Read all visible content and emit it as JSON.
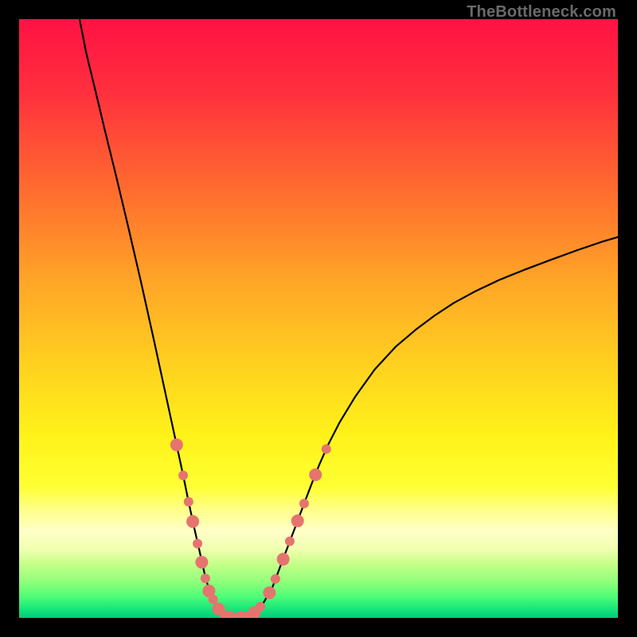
{
  "watermark": "TheBottleneck.com",
  "gradient_stops": [
    {
      "offset": 0.0,
      "color": "#ff1244"
    },
    {
      "offset": 0.12,
      "color": "#ff2f3e"
    },
    {
      "offset": 0.28,
      "color": "#ff6a2f"
    },
    {
      "offset": 0.44,
      "color": "#ffa627"
    },
    {
      "offset": 0.58,
      "color": "#ffd21f"
    },
    {
      "offset": 0.7,
      "color": "#fff31a"
    },
    {
      "offset": 0.78,
      "color": "#ffff33"
    },
    {
      "offset": 0.82,
      "color": "#ffff8a"
    },
    {
      "offset": 0.855,
      "color": "#ffffc8"
    },
    {
      "offset": 0.885,
      "color": "#f0ffb0"
    },
    {
      "offset": 0.91,
      "color": "#c6ff88"
    },
    {
      "offset": 0.94,
      "color": "#8fff7a"
    },
    {
      "offset": 0.965,
      "color": "#4dfd78"
    },
    {
      "offset": 0.985,
      "color": "#17e67a"
    },
    {
      "offset": 1.0,
      "color": "#00cc7a"
    }
  ],
  "curve_style": {
    "stroke": "#000000",
    "stroke_width": 2.2
  },
  "marker_style": {
    "fill": "#e5746f",
    "radius_large": 8,
    "radius_small": 6
  },
  "chart_data": {
    "type": "line",
    "title": "",
    "xlabel": "",
    "ylabel": "",
    "xlim": [
      0,
      100
    ],
    "ylim": [
      0,
      100
    ],
    "grid": false,
    "note": "Axes are unlabeled. x/y values are normalized 0–100 from pixel position; y is measured upward (0 at bottom of plot, 100 at top).",
    "series": [
      {
        "name": "curve",
        "style": "black-line",
        "x": [
          10.1,
          11.2,
          12.8,
          14.4,
          16.2,
          18.2,
          20.4,
          22.6,
          24.7,
          26.3,
          27.4,
          28.3,
          29.3,
          30.1,
          30.9,
          31.6,
          32.4,
          33.2,
          34.0,
          35.1,
          36.3,
          37.5,
          38.6,
          39.6,
          40.8,
          42.3,
          44.0,
          45.9,
          47.6,
          48.9,
          50.1,
          51.6,
          53.5,
          56.1,
          59.4,
          62.9,
          66.2,
          69.4,
          72.6,
          76.1,
          80.1,
          84.3,
          88.8,
          93.2,
          97.3,
          100.0
        ],
        "y": [
          100.0,
          94.4,
          87.8,
          81.1,
          73.8,
          65.4,
          55.9,
          46.0,
          36.3,
          28.9,
          23.8,
          19.4,
          14.8,
          11.3,
          7.7,
          5.1,
          3.1,
          1.6,
          0.7,
          0.1,
          0.0,
          0.1,
          0.4,
          1.1,
          2.5,
          5.1,
          9.6,
          14.6,
          19.1,
          22.5,
          25.5,
          28.9,
          32.6,
          36.9,
          41.5,
          45.3,
          48.1,
          50.5,
          52.6,
          54.5,
          56.4,
          58.1,
          59.8,
          61.4,
          62.8,
          63.6
        ]
      },
      {
        "name": "markers",
        "style": "salmon-dots",
        "points": [
          {
            "x": 26.3,
            "y": 28.9,
            "size": "large"
          },
          {
            "x": 27.4,
            "y": 23.8,
            "size": "small"
          },
          {
            "x": 28.3,
            "y": 19.4,
            "size": "small"
          },
          {
            "x": 29.0,
            "y": 16.1,
            "size": "large"
          },
          {
            "x": 29.8,
            "y": 12.4,
            "size": "small"
          },
          {
            "x": 30.5,
            "y": 9.3,
            "size": "large"
          },
          {
            "x": 31.1,
            "y": 6.6,
            "size": "small"
          },
          {
            "x": 31.7,
            "y": 4.5,
            "size": "large"
          },
          {
            "x": 32.4,
            "y": 3.1,
            "size": "small"
          },
          {
            "x": 33.3,
            "y": 1.5,
            "size": "large"
          },
          {
            "x": 34.3,
            "y": 0.5,
            "size": "small"
          },
          {
            "x": 35.2,
            "y": 0.1,
            "size": "large"
          },
          {
            "x": 36.2,
            "y": 0.0,
            "size": "small"
          },
          {
            "x": 37.1,
            "y": 0.1,
            "size": "large"
          },
          {
            "x": 38.2,
            "y": 0.3,
            "size": "small"
          },
          {
            "x": 39.3,
            "y": 0.9,
            "size": "large"
          },
          {
            "x": 40.3,
            "y": 1.9,
            "size": "small"
          },
          {
            "x": 41.8,
            "y": 4.2,
            "size": "large"
          },
          {
            "x": 42.8,
            "y": 6.5,
            "size": "small"
          },
          {
            "x": 44.1,
            "y": 9.8,
            "size": "large"
          },
          {
            "x": 45.2,
            "y": 12.8,
            "size": "small"
          },
          {
            "x": 46.5,
            "y": 16.2,
            "size": "large"
          },
          {
            "x": 47.6,
            "y": 19.1,
            "size": "small"
          },
          {
            "x": 49.5,
            "y": 23.9,
            "size": "large"
          },
          {
            "x": 51.3,
            "y": 28.2,
            "size": "small"
          }
        ]
      }
    ]
  }
}
